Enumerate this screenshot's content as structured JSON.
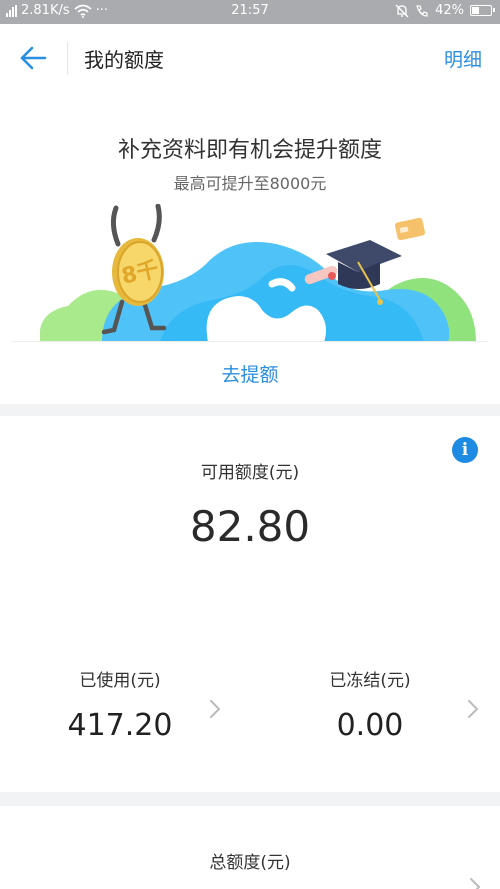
{
  "status_bar": {
    "network_speed": "2.81K/s",
    "more": "···",
    "time": "21:57",
    "battery": "42%",
    "battery_level": 0.42
  },
  "header": {
    "title": "我的额度",
    "detail_link": "明细"
  },
  "promo": {
    "headline": "补充资料即有机会提升额度",
    "subline": "最高可提升至8000元",
    "coin_text": "8千",
    "cta": "去提额"
  },
  "quota": {
    "available_label": "可用额度(元)",
    "available_value": "82.80",
    "info_icon": "i",
    "used_label": "已使用(元)",
    "used_value": "417.20",
    "frozen_label": "已冻结(元)",
    "frozen_value": "0.00"
  },
  "total": {
    "label": "总额度(元)"
  },
  "colors": {
    "accent": "#2a8ee0",
    "info": "#1d8be2",
    "status_bar": "#a9abae",
    "page_bg": "#f2f3f5"
  },
  "icons": [
    "back-arrow-icon",
    "signal-icon",
    "wifi-icon",
    "bell-muted-icon",
    "phone-icon",
    "battery-icon",
    "info-icon",
    "chevron-right-icon"
  ]
}
